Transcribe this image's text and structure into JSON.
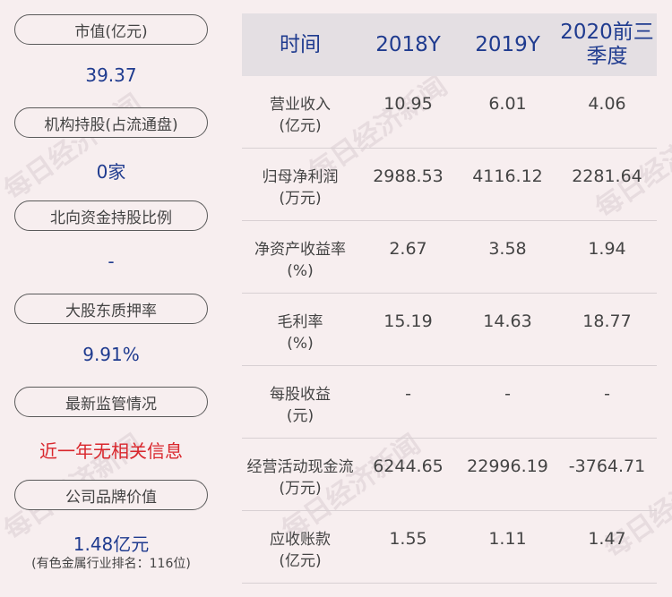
{
  "left": {
    "items": [
      {
        "label": "市值(亿元)",
        "value": "39.37"
      },
      {
        "label": "机构持股(占流通盘)",
        "value": "0家"
      },
      {
        "label": "北向资金持股比例",
        "value": "-"
      },
      {
        "label": "大股东质押率",
        "value": "9.91%"
      },
      {
        "label": "最新监管情况",
        "value": "近一年无相关信息"
      },
      {
        "label": "公司品牌价值",
        "value": "1.48亿元",
        "sub": "(有色金属行业排名：116位)"
      }
    ]
  },
  "table": {
    "headers": [
      "时间",
      "2018Y",
      "2019Y",
      "2020前三季度"
    ],
    "rows": [
      {
        "label": "营业收入",
        "unit": "(亿元)",
        "values": [
          "10.95",
          "6.01",
          "4.06"
        ]
      },
      {
        "label": "归母净利润",
        "unit": "(万元)",
        "values": [
          "2988.53",
          "4116.12",
          "2281.64"
        ]
      },
      {
        "label": "净资产收益率",
        "unit": "(%)",
        "values": [
          "2.67",
          "3.58",
          "1.94"
        ]
      },
      {
        "label": "毛利率",
        "unit": "(%)",
        "values": [
          "15.19",
          "14.63",
          "18.77"
        ]
      },
      {
        "label": "每股收益",
        "unit": "(元)",
        "values": [
          "-",
          "-",
          "-"
        ]
      },
      {
        "label": "经营活动现金流",
        "unit": "(万元)",
        "values": [
          "6244.65",
          "22996.19",
          "-3764.71"
        ]
      },
      {
        "label": "应收账款",
        "unit": "(亿元)",
        "values": [
          "1.55",
          "1.11",
          "1.47"
        ]
      }
    ]
  },
  "watermark": "每日经济新闻",
  "colors": {
    "background": "#f7eeef",
    "value_blue": "#1f3b8f",
    "alert_red": "#d9262c",
    "header_bg": "#e4dfe3"
  }
}
